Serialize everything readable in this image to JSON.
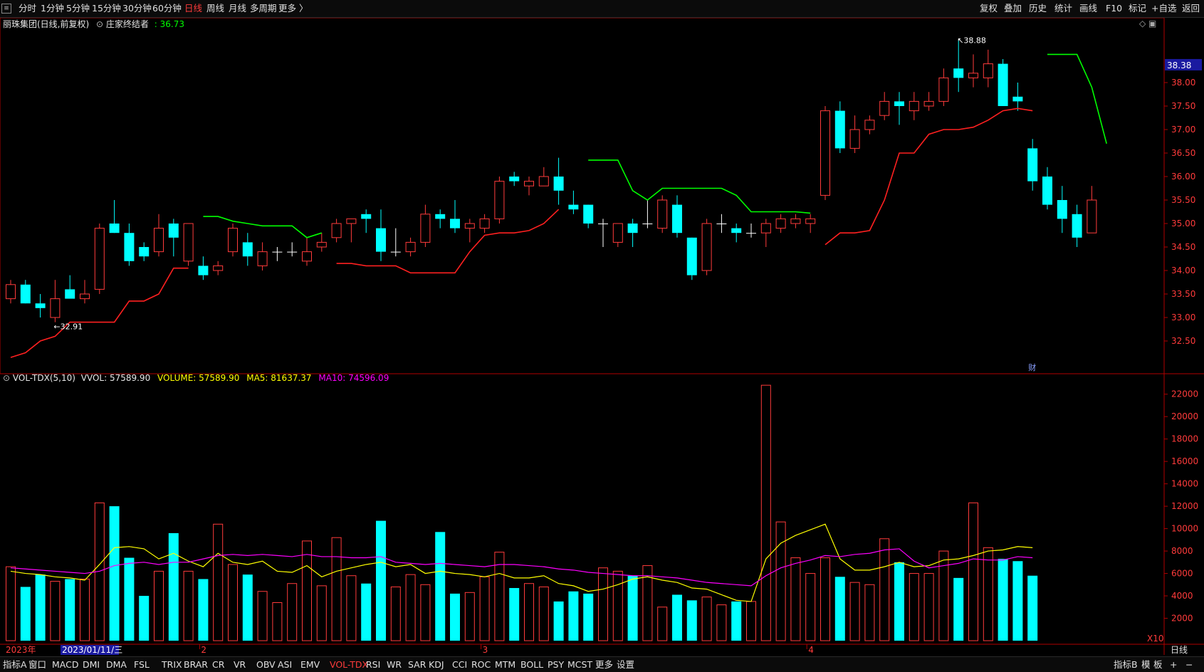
{
  "topbar": {
    "periods": [
      "分时",
      "1分钟",
      "5分钟",
      "15分钟",
      "30分钟",
      "60分钟",
      "日线",
      "周线",
      "月线",
      "多周期",
      "更多 〉"
    ],
    "active_period": "日线",
    "right_buttons": [
      "复权",
      "叠加",
      "历史",
      "统计",
      "画线",
      "F10",
      "标记",
      "+自选",
      "返回"
    ]
  },
  "info": {
    "stock_name": "丽珠集团(日线,前复权)",
    "indicator_name": "庄家终结者",
    "indicator_value": ": 36.73",
    "corner_icons": "◇ ▣"
  },
  "vol_header": {
    "name": "VOL-TDX(5,10)",
    "vvol": "VVOL: 57589.90",
    "volume": "VOLUME: 57589.90",
    "ma5": "MA5: 81637.37",
    "ma10": "MA10: 74596.09"
  },
  "price_axis": {
    "ticks": [
      "38.00",
      "37.50",
      "37.00",
      "36.50",
      "36.00",
      "35.50",
      "35.00",
      "34.50",
      "34.00",
      "33.50",
      "33.00",
      "32.50"
    ],
    "current_price": "38.38"
  },
  "vol_axis": {
    "ticks": [
      "22000",
      "20000",
      "18000",
      "16000",
      "14000",
      "12000",
      "10000",
      "8000",
      "6000",
      "4000",
      "2000"
    ],
    "unit": "X10"
  },
  "date_axis": {
    "year_label": "2023年",
    "cursor_date": "2023/01/11/三",
    "month_labels": [
      "2",
      "3",
      "4"
    ]
  },
  "annotations": {
    "high": "38.88",
    "low": "32.91",
    "fin_marker": "财"
  },
  "bottombar": {
    "left_tab": "指标A",
    "window_tab": "窗口",
    "indicators": [
      "MACD",
      "DMI",
      "DMA",
      "FSL",
      "TRIX",
      "BRAR",
      "CR",
      "VR",
      "OBV",
      "ASI",
      "EMV",
      "VOL-TDX",
      "RSI",
      "WR",
      "SAR",
      "KDJ",
      "CCI",
      "ROC",
      "MTM",
      "BOLL",
      "PSY",
      "MCST",
      "更多",
      "设置"
    ],
    "active_indicator": "VOL-TDX",
    "right_tabs": [
      "指标B",
      "模",
      "板",
      "+",
      "−"
    ],
    "right_label": "日线"
  },
  "colors": {
    "up": "#ff3b3b",
    "down": "#00ffff",
    "indicator_green": "#00ff00",
    "indicator_red": "#ff2020",
    "ma5": "#ffff00",
    "ma10": "#ff00ff",
    "axis": "#b00000"
  },
  "chart_data": {
    "type": "candlestick",
    "price_range": [
      32.0,
      39.0
    ],
    "volume_range": [
      0,
      23000
    ],
    "ohlc": [
      [
        33.4,
        33.8,
        33.3,
        33.7
      ],
      [
        33.7,
        33.8,
        33.3,
        33.3
      ],
      [
        33.3,
        33.5,
        33.0,
        33.2
      ],
      [
        33.0,
        33.8,
        32.9,
        33.4
      ],
      [
        33.6,
        33.9,
        33.5,
        33.4
      ],
      [
        33.4,
        33.8,
        33.3,
        33.5
      ],
      [
        33.6,
        35.0,
        33.5,
        34.9
      ],
      [
        35.0,
        35.5,
        34.8,
        34.8
      ],
      [
        34.8,
        35.0,
        34.1,
        34.2
      ],
      [
        34.5,
        34.6,
        34.2,
        34.3
      ],
      [
        34.4,
        35.2,
        34.3,
        34.9
      ],
      [
        35.0,
        35.1,
        34.3,
        34.7
      ],
      [
        34.2,
        35.0,
        34.1,
        35.0
      ],
      [
        34.1,
        34.3,
        33.8,
        33.9
      ],
      [
        34.0,
        34.2,
        33.9,
        34.1
      ],
      [
        34.4,
        35.0,
        34.3,
        34.9
      ],
      [
        34.6,
        34.8,
        34.1,
        34.3
      ],
      [
        34.1,
        34.6,
        34.0,
        34.4
      ],
      [
        34.4,
        34.5,
        34.2,
        34.4
      ],
      [
        34.4,
        34.6,
        34.3,
        34.4
      ],
      [
        34.2,
        34.7,
        34.1,
        34.4
      ],
      [
        34.5,
        34.8,
        34.4,
        34.6
      ],
      [
        34.7,
        35.1,
        34.6,
        35.0
      ],
      [
        35.0,
        35.1,
        34.6,
        35.1
      ],
      [
        35.2,
        35.3,
        34.8,
        35.1
      ],
      [
        34.9,
        35.3,
        34.2,
        34.4
      ],
      [
        34.4,
        34.9,
        34.3,
        34.4
      ],
      [
        34.4,
        34.7,
        34.3,
        34.6
      ],
      [
        34.6,
        35.4,
        34.5,
        35.2
      ],
      [
        35.2,
        35.3,
        34.9,
        35.1
      ],
      [
        35.1,
        35.5,
        34.8,
        34.9
      ],
      [
        34.9,
        35.1,
        34.6,
        35.0
      ],
      [
        34.9,
        35.2,
        34.8,
        35.1
      ],
      [
        35.1,
        36.0,
        35.0,
        35.9
      ],
      [
        36.0,
        36.1,
        35.8,
        35.9
      ],
      [
        35.8,
        36.0,
        35.6,
        35.9
      ],
      [
        35.8,
        36.2,
        35.8,
        36.0
      ],
      [
        36.0,
        36.4,
        35.4,
        35.7
      ],
      [
        35.4,
        35.7,
        35.2,
        35.3
      ],
      [
        35.4,
        35.4,
        34.9,
        35.0
      ],
      [
        35.0,
        35.1,
        34.5,
        35.0
      ],
      [
        34.6,
        35.0,
        34.5,
        35.0
      ],
      [
        35.0,
        35.1,
        34.5,
        34.8
      ],
      [
        35.0,
        35.5,
        34.9,
        35.0
      ],
      [
        34.9,
        35.6,
        34.8,
        35.5
      ],
      [
        35.4,
        35.6,
        34.7,
        34.8
      ],
      [
        34.7,
        34.7,
        33.8,
        33.9
      ],
      [
        34.0,
        35.1,
        33.9,
        35.0
      ],
      [
        35.0,
        35.2,
        34.8,
        35.0
      ],
      [
        34.9,
        35.0,
        34.6,
        34.8
      ],
      [
        34.8,
        35.0,
        34.7,
        34.8
      ],
      [
        34.8,
        35.1,
        34.5,
        35.0
      ],
      [
        34.9,
        35.2,
        34.8,
        35.1
      ],
      [
        35.0,
        35.2,
        34.9,
        35.1
      ],
      [
        35.0,
        35.2,
        34.8,
        35.1
      ],
      [
        35.6,
        37.5,
        35.5,
        37.4
      ],
      [
        37.4,
        37.6,
        36.5,
        36.6
      ],
      [
        36.6,
        37.3,
        36.5,
        37.0
      ],
      [
        37.0,
        37.3,
        36.9,
        37.2
      ],
      [
        37.3,
        37.8,
        37.2,
        37.6
      ],
      [
        37.6,
        37.8,
        37.1,
        37.5
      ],
      [
        37.4,
        37.8,
        37.2,
        37.6
      ],
      [
        37.5,
        37.8,
        37.4,
        37.6
      ],
      [
        37.6,
        38.3,
        37.5,
        38.1
      ],
      [
        38.3,
        38.9,
        37.8,
        38.1
      ],
      [
        38.1,
        38.6,
        37.9,
        38.2
      ],
      [
        38.1,
        38.7,
        37.9,
        38.4
      ],
      [
        38.4,
        38.5,
        37.5,
        37.5
      ],
      [
        37.7,
        38.0,
        37.4,
        37.6
      ],
      [
        36.6,
        36.8,
        35.7,
        35.9
      ],
      [
        36.0,
        36.2,
        35.3,
        35.4
      ],
      [
        35.5,
        35.8,
        34.8,
        35.1
      ],
      [
        35.2,
        35.4,
        34.5,
        34.7
      ],
      [
        34.8,
        35.8,
        34.8,
        35.5
      ]
    ],
    "volume": [
      6600,
      4800,
      5900,
      5300,
      5500,
      5500,
      12300,
      12000,
      7400,
      4000,
      6200,
      9600,
      6200,
      5500,
      10400,
      6800,
      5900,
      4400,
      3400,
      5100,
      8900,
      4900,
      9200,
      5800,
      5100,
      10700,
      4800,
      5900,
      5000,
      9700,
      4200,
      4300,
      5700,
      7900,
      4700,
      5100,
      4800,
      3500,
      4400,
      4200,
      6500,
      6200,
      5800,
      6700,
      3000,
      4100,
      3600,
      3900,
      3200,
      3500,
      3500,
      22800,
      10600,
      7400,
      6000,
      7400,
      5700,
      5200,
      5000,
      9100,
      7000,
      6000,
      6000,
      8000,
      5600,
      12300,
      8300,
      7300,
      7100,
      5800
    ],
    "ma5": [
      6200,
      6000,
      5900,
      5700,
      5600,
      5400,
      6800,
      8300,
      8400,
      8200,
      7300,
      7800,
      7100,
      6600,
      7800,
      7000,
      6800,
      7100,
      6200,
      6100,
      6700,
      5700,
      6200,
      6500,
      6800,
      7000,
      6600,
      6800,
      6000,
      6200,
      6000,
      5900,
      5700,
      6000,
      5600,
      5600,
      5800,
      5100,
      4900,
      4400,
      4600,
      5000,
      5500,
      5700,
      5400,
      5200,
      4700,
      4600,
      4100,
      3600,
      3500,
      7300,
      8700,
      9400,
      9900,
      10400,
      7300,
      6300,
      6300,
      6600,
      7000,
      6600,
      6700,
      7200,
      7300,
      7600,
      8000,
      8100,
      8400,
      8300
    ],
    "ma10": [
      6500,
      6400,
      6300,
      6200,
      6100,
      6000,
      6200,
      6700,
      6900,
      7000,
      6800,
      7000,
      7000,
      7300,
      7600,
      7700,
      7600,
      7700,
      7600,
      7500,
      7700,
      7500,
      7500,
      7400,
      7400,
      7500,
      7000,
      6900,
      6800,
      6900,
      6800,
      6700,
      6600,
      6800,
      6800,
      6700,
      6600,
      6400,
      6300,
      6100,
      6000,
      5900,
      5800,
      5800,
      5700,
      5600,
      5400,
      5200,
      5100,
      5000,
      4900,
      5800,
      6500,
      6900,
      7200,
      7600,
      7500,
      7700,
      7800,
      8100,
      8200,
      7100,
      6500,
      6700,
      6900,
      7300,
      7200,
      7200,
      7500,
      7400
    ],
    "indicator_green": [
      [
        13,
        35.15
      ],
      [
        14,
        35.15
      ],
      [
        15,
        35.05
      ],
      [
        16,
        35.0
      ],
      [
        17,
        34.95
      ],
      [
        18,
        34.95
      ],
      [
        19,
        34.95
      ],
      [
        20,
        34.7
      ],
      [
        21,
        34.8
      ],
      [
        39,
        36.35
      ],
      [
        40,
        36.35
      ],
      [
        41,
        36.35
      ],
      [
        42,
        35.7
      ],
      [
        43,
        35.5
      ],
      [
        44,
        35.75
      ],
      [
        45,
        35.75
      ],
      [
        46,
        35.75
      ],
      [
        47,
        35.75
      ],
      [
        48,
        35.75
      ],
      [
        49,
        35.6
      ],
      [
        50,
        35.25
      ],
      [
        51,
        35.25
      ],
      [
        52,
        35.25
      ],
      [
        53,
        35.25
      ],
      [
        54,
        35.22
      ],
      [
        70,
        38.6
      ],
      [
        71,
        38.6
      ],
      [
        72,
        38.6
      ],
      [
        73,
        37.9
      ],
      [
        74,
        36.7
      ]
    ],
    "indicator_red": [
      [
        0,
        32.15
      ],
      [
        1,
        32.25
      ],
      [
        2,
        32.5
      ],
      [
        3,
        32.6
      ],
      [
        4,
        32.9
      ],
      [
        5,
        32.9
      ],
      [
        6,
        32.9
      ],
      [
        7,
        32.9
      ],
      [
        8,
        33.35
      ],
      [
        9,
        33.35
      ],
      [
        10,
        33.5
      ],
      [
        11,
        34.05
      ],
      [
        12,
        34.05
      ],
      [
        22,
        34.15
      ],
      [
        23,
        34.15
      ],
      [
        24,
        34.1
      ],
      [
        25,
        34.1
      ],
      [
        26,
        34.1
      ],
      [
        27,
        33.95
      ],
      [
        28,
        33.95
      ],
      [
        29,
        33.95
      ],
      [
        30,
        33.95
      ],
      [
        31,
        34.4
      ],
      [
        32,
        34.75
      ],
      [
        33,
        34.8
      ],
      [
        34,
        34.8
      ],
      [
        35,
        34.85
      ],
      [
        36,
        35.0
      ],
      [
        37,
        35.3
      ],
      [
        55,
        34.55
      ],
      [
        56,
        34.8
      ],
      [
        57,
        34.8
      ],
      [
        58,
        34.85
      ],
      [
        59,
        35.5
      ],
      [
        60,
        36.5
      ],
      [
        61,
        36.5
      ],
      [
        62,
        36.9
      ],
      [
        63,
        37.0
      ],
      [
        64,
        37.0
      ],
      [
        65,
        37.05
      ],
      [
        66,
        37.2
      ],
      [
        67,
        37.4
      ],
      [
        68,
        37.45
      ],
      [
        69,
        37.4
      ]
    ]
  }
}
